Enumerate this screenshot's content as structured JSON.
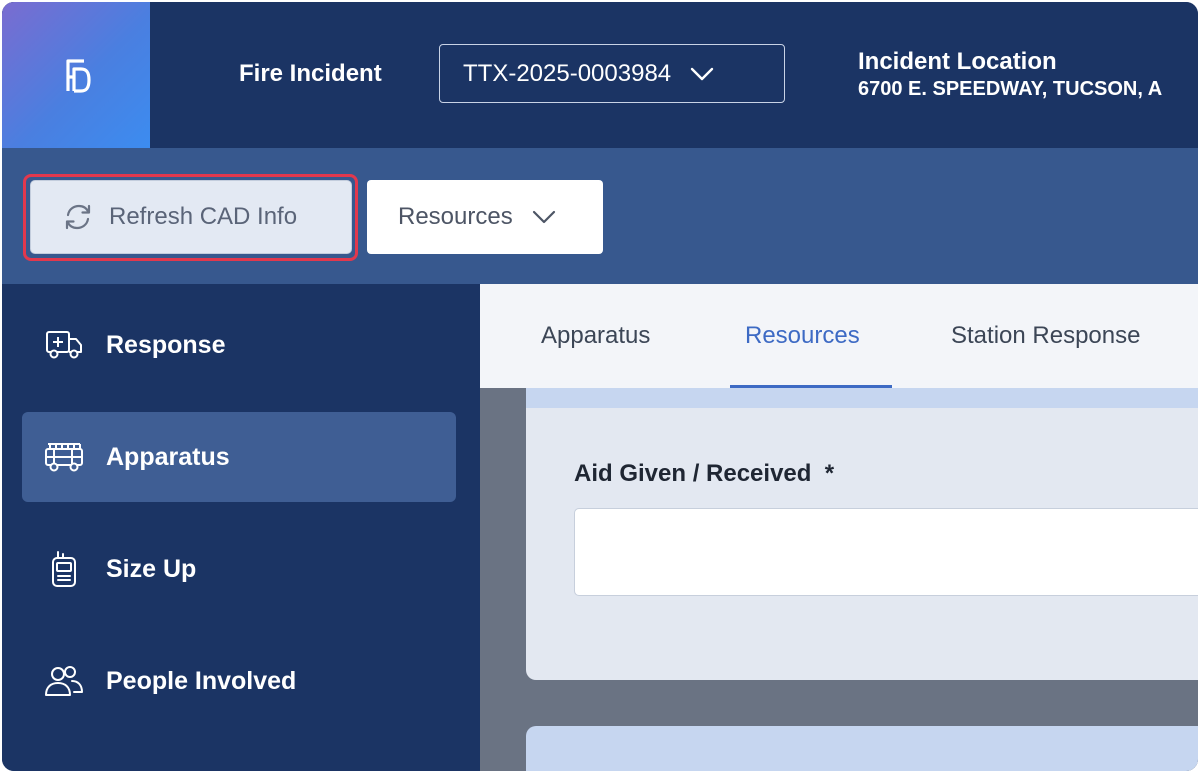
{
  "header": {
    "app_title": "Fire Incident",
    "incident_number": "TTX-2025-0003984",
    "location_title": "Incident Location",
    "location_address": "6700 E. SPEEDWAY, TUCSON, A"
  },
  "toolbar": {
    "refresh_label": "Refresh CAD Info",
    "resources_label": "Resources"
  },
  "sidebar": {
    "items": [
      {
        "label": "Response",
        "icon": "ambulance-icon"
      },
      {
        "label": "Apparatus",
        "icon": "fire-truck-icon",
        "active": true
      },
      {
        "label": "Size Up",
        "icon": "radio-icon"
      },
      {
        "label": "People Involved",
        "icon": "people-icon"
      }
    ]
  },
  "tabs": [
    {
      "label": "Apparatus"
    },
    {
      "label": "Resources",
      "active": true
    },
    {
      "label": "Station Response"
    }
  ],
  "form": {
    "aid_label": "Aid Given / Received",
    "required_marker": "*",
    "aid_value": ""
  },
  "colors": {
    "header_bg": "#1b3464",
    "toolbar_bg": "#37588e",
    "accent": "#3d6ac4",
    "highlight": "#e2384d"
  }
}
